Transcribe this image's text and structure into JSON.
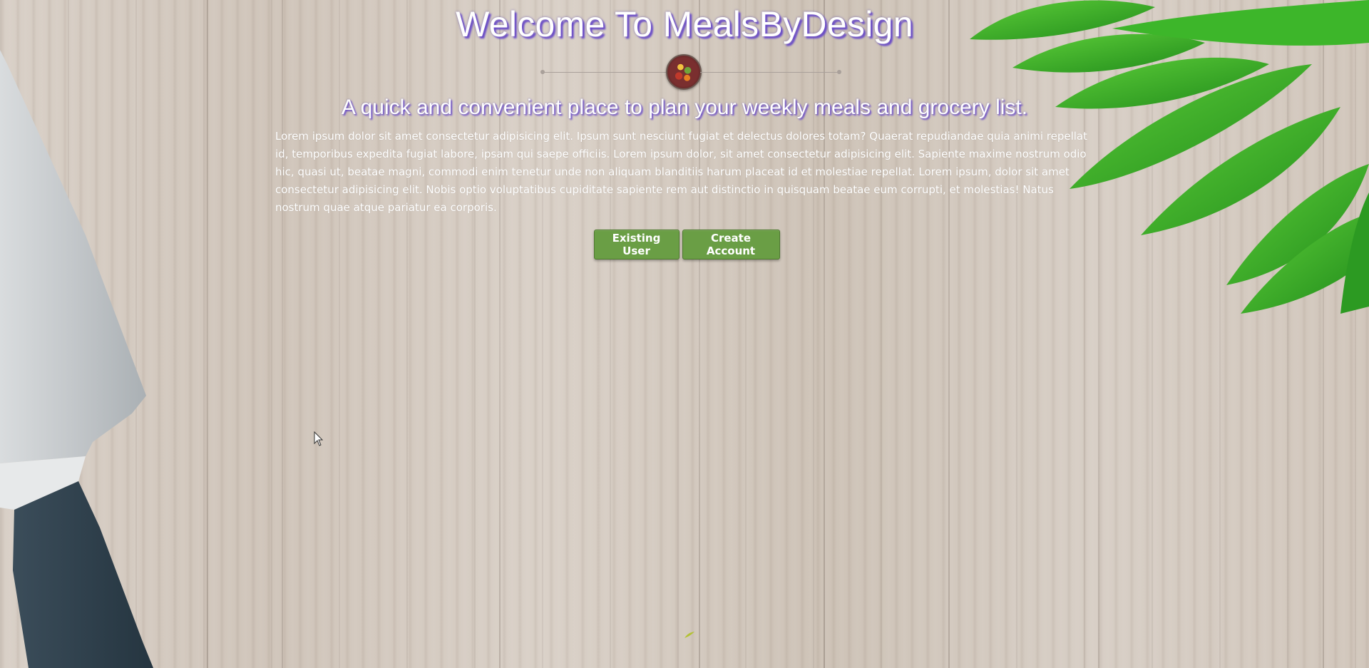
{
  "page": {
    "title": "Welcome To MealsByDesign",
    "subtitle": "A quick and convenient place to plan your weekly meals and grocery list.",
    "body": "Lorem ipsum dolor sit amet consectetur adipisicing elit. Ipsum sunt nesciunt fugiat et delectus dolores totam? Quaerat repudiandae quia animi repellat id, temporibus expedita fugiat labore, ipsam qui saepe officiis. Lorem ipsum dolor, sit amet consectetur adipisicing elit. Sapiente maxime nostrum odio hic, quasi ut, beatae magni, commodi enim tenetur unde non aliquam blanditiis harum placeat id et molestiae repellat. Lorem ipsum, dolor sit amet consectetur adipisicing elit. Nobis optio voluptatibus cupiditate sapiente rem aut distinctio in quisquam beatae eum corrupti, et molestias! Natus nostrum quae atque pariatur ea corporis."
  },
  "logo": {
    "icon": "meal-plate-logo-icon"
  },
  "actions": {
    "existing_user_label": "Existing User",
    "create_account_label": "Create Account"
  },
  "colors": {
    "title_shadow": "#6a4cc7",
    "button_bg": "#6a9e45",
    "button_border": "#4c7a2d",
    "text": "#ffffff"
  }
}
